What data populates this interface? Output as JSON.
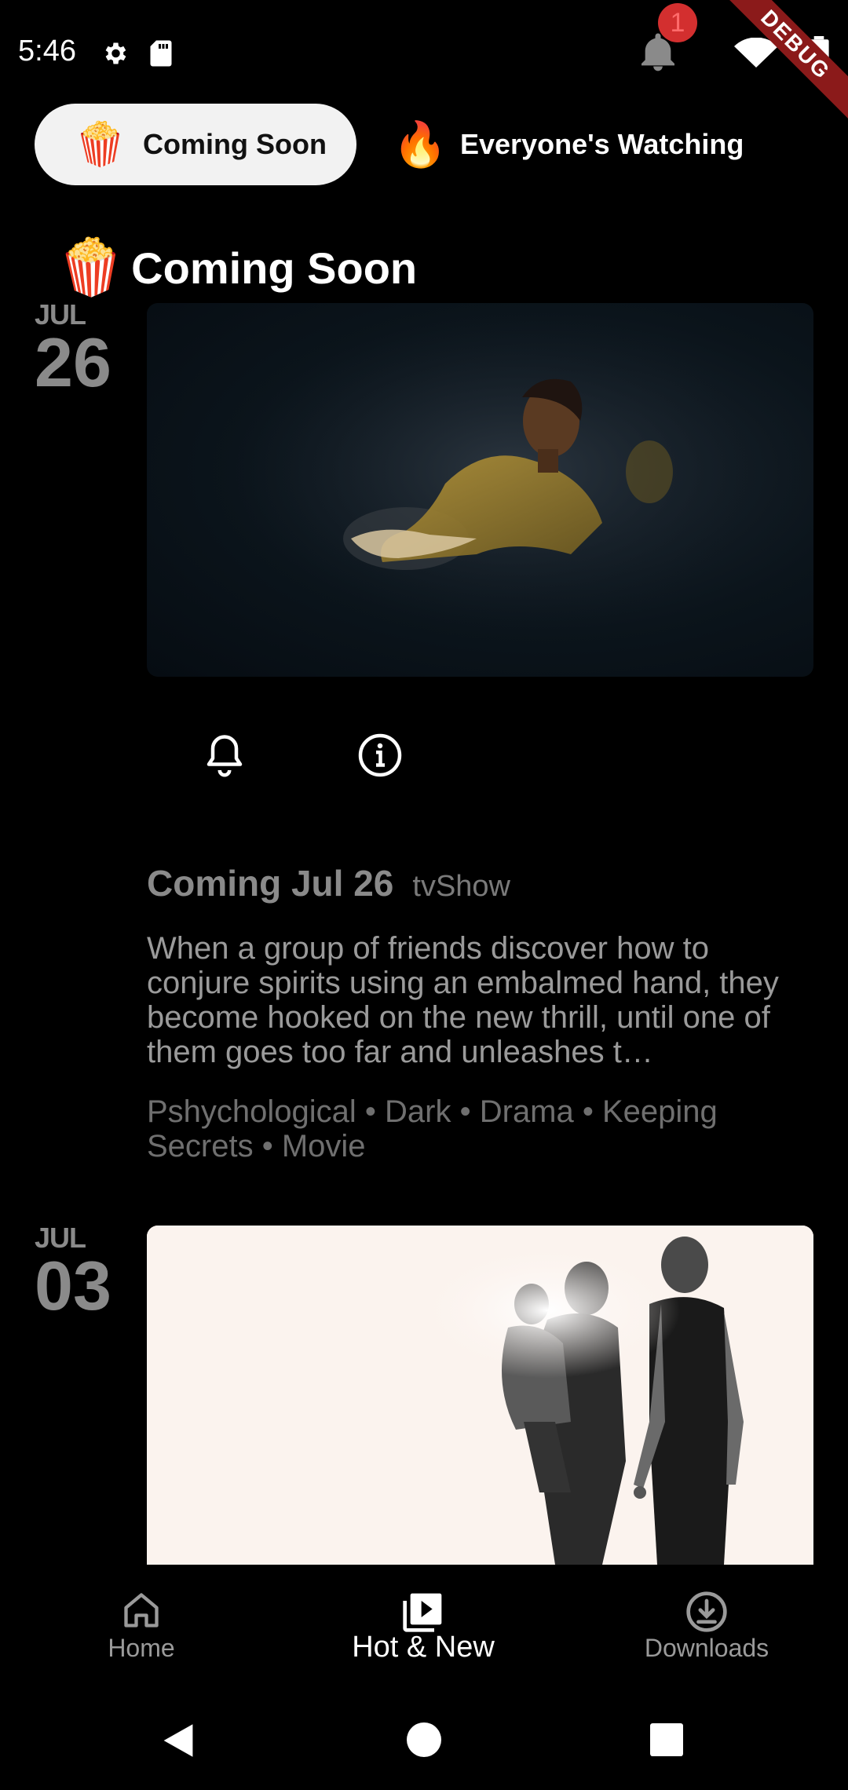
{
  "status_bar": {
    "time": "5:46",
    "notification_count": "1",
    "debug_label": "DEBUG"
  },
  "tabs": [
    {
      "emoji": "🍿",
      "label": "Coming Soon",
      "selected": true
    },
    {
      "emoji": "🔥",
      "label": "Everyone's Watching",
      "selected": false
    }
  ],
  "section": {
    "emoji": "🍿",
    "title": "Coming Soon"
  },
  "items": [
    {
      "month": "JUL",
      "day": "26",
      "coming_label": "Coming Jul 26",
      "type": "tvShow",
      "description": "When a group of friends discover how to conjure spirits using an embalmed hand, they become hooked on the new thrill, until one of them goes too far and unleashes t…",
      "genres": "Pshychological • Dark • Drama • Keeping Secrets • Movie"
    },
    {
      "month": "JUL",
      "day": "03"
    }
  ],
  "bottom_nav": {
    "home": "Home",
    "hot_new": "Hot & New",
    "downloads": "Downloads",
    "active": "hot_new"
  },
  "colors": {
    "background": "#000000",
    "selected_tab_bg": "#f2f2f2",
    "badge": "#d32f2f",
    "muted_text": "#8a8a8a"
  }
}
